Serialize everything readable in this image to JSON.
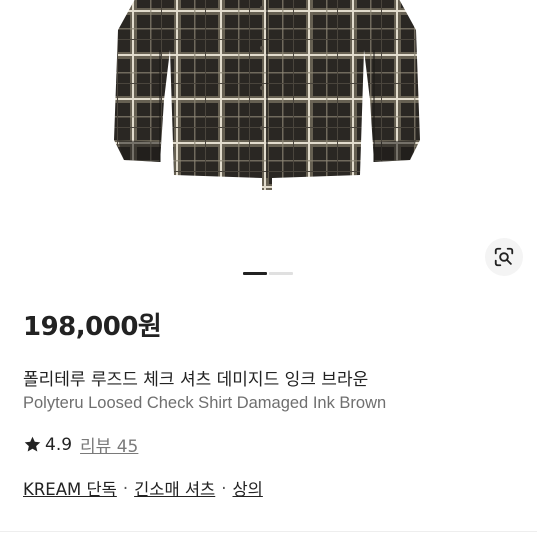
{
  "product": {
    "price": "198,000원",
    "name_ko": "폴리테루 루즈드 체크 셔츠 데미지드 잉크 브라운",
    "name_en": "Polyteru Loosed Check Shirt Damaged Ink Brown",
    "rating": "4.9",
    "review_label": "리뷰 45"
  },
  "categories": [
    {
      "label": "KREAM 단독"
    },
    {
      "label": "긴소매 셔츠"
    },
    {
      "label": "상의"
    }
  ],
  "separator": "·",
  "gallery": {
    "slide_count": 2,
    "active_slide": 1
  },
  "icons": {
    "lens": "lens-search-icon",
    "star": "star-icon"
  },
  "colors": {
    "shirt_dark": "#2a2723",
    "check_light": "#d8d0c0",
    "star": "#222222"
  }
}
